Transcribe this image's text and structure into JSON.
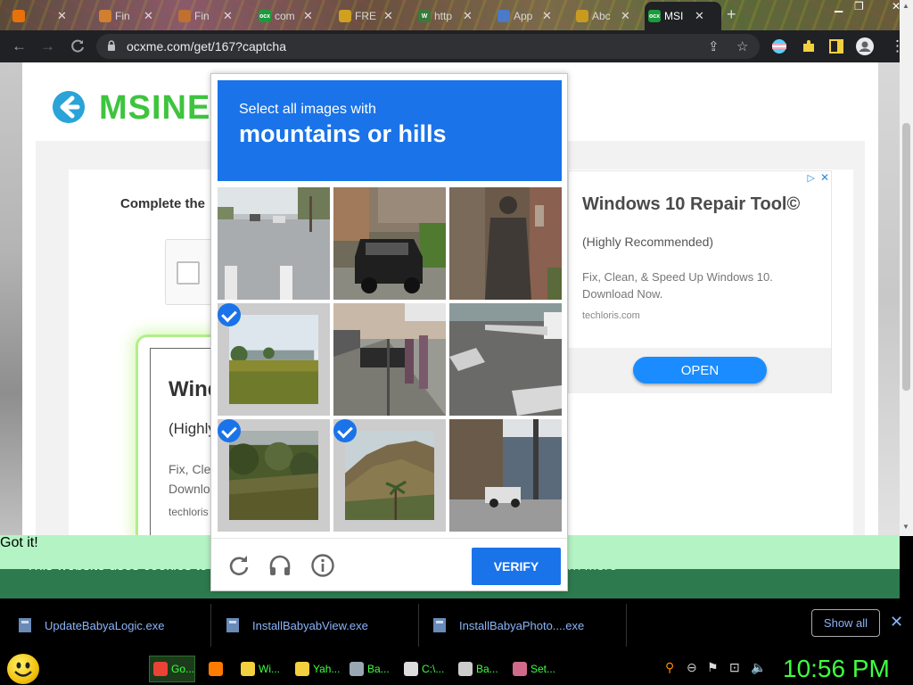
{
  "browser": {
    "tabs": [
      {
        "title": "",
        "fav_color": "#e8710a",
        "fav_text": ""
      },
      {
        "title": "Fin",
        "fav_color": "#d08030",
        "fav_text": ""
      },
      {
        "title": "Fin",
        "fav_color": "#c07030",
        "fav_text": ""
      },
      {
        "title": "com",
        "fav_color": "#1a9b3c",
        "fav_text": "ocx"
      },
      {
        "title": "FRE",
        "fav_color": "#d0a020",
        "fav_text": ""
      },
      {
        "title": "http",
        "fav_color": "#3a7a3a",
        "fav_text": "W"
      },
      {
        "title": "App",
        "fav_color": "#4a7ac8",
        "fav_text": ""
      },
      {
        "title": "Abc",
        "fav_color": "#c89a20",
        "fav_text": ""
      },
      {
        "title": "MSI",
        "fav_color": "#1a9b3c",
        "fav_text": "ocx"
      }
    ],
    "new_tab_label": "+",
    "url": "ocxme.com/get/167?captcha"
  },
  "page": {
    "site_title": "MSINET",
    "complete_text": "Complete the",
    "ad_right": {
      "title": "Windows 10 Repair Tool©",
      "subtitle": "(Highly Recommended)",
      "desc": "Fix, Clean, & Speed Up Windows 10. Download Now.",
      "domain": "techloris.com",
      "cta": "OPEN",
      "ad_choice": "▷",
      "close": "✕"
    },
    "ad_left": {
      "title": "Wind",
      "subtitle": "(Highly",
      "desc_1": "Fix, Cle",
      "desc_2": "Downlo",
      "domain": "techloris"
    }
  },
  "captcha": {
    "instruction": "Select all images with",
    "target": "mountains or hills",
    "verify_label": "VERIFY",
    "tiles": [
      {
        "desc": "street crosswalk",
        "selected": false
      },
      {
        "desc": "parked car",
        "selected": false
      },
      {
        "desc": "statue",
        "selected": false
      },
      {
        "desc": "grass field",
        "selected": true
      },
      {
        "desc": "sidewalk motorcycles",
        "selected": false
      },
      {
        "desc": "road crosswalk",
        "selected": false
      },
      {
        "desc": "shrubs",
        "selected": true
      },
      {
        "desc": "hill with palm",
        "selected": true
      },
      {
        "desc": "street houses",
        "selected": false
      }
    ]
  },
  "cookie": {
    "message": "This website uses cookies to",
    "learn_more": "rn more",
    "got_it": "Got it!"
  },
  "downloads": {
    "items": [
      {
        "name": "UpdateBabyaLogic.exe"
      },
      {
        "name": "InstallBabyabView.exe"
      },
      {
        "name": "InstallBabyaPhoto....exe"
      }
    ],
    "show_all": "Show all",
    "close": "✕"
  },
  "taskbar": {
    "tasks": [
      {
        "label": "Go...",
        "color": "#ea4335"
      },
      {
        "label": "",
        "color": "#ff7b00"
      },
      {
        "label": "Wi...",
        "color": "#f4d03f"
      },
      {
        "label": "Yah...",
        "color": "#f4d03f"
      },
      {
        "label": "Ba...",
        "color": "#9aa7b3"
      },
      {
        "label": "C:\\...",
        "color": "#dddddd"
      },
      {
        "label": "Ba...",
        "color": "#cccccc"
      },
      {
        "label": "Set...",
        "color": "#d06a8a"
      }
    ],
    "clock": "10:56 PM"
  }
}
